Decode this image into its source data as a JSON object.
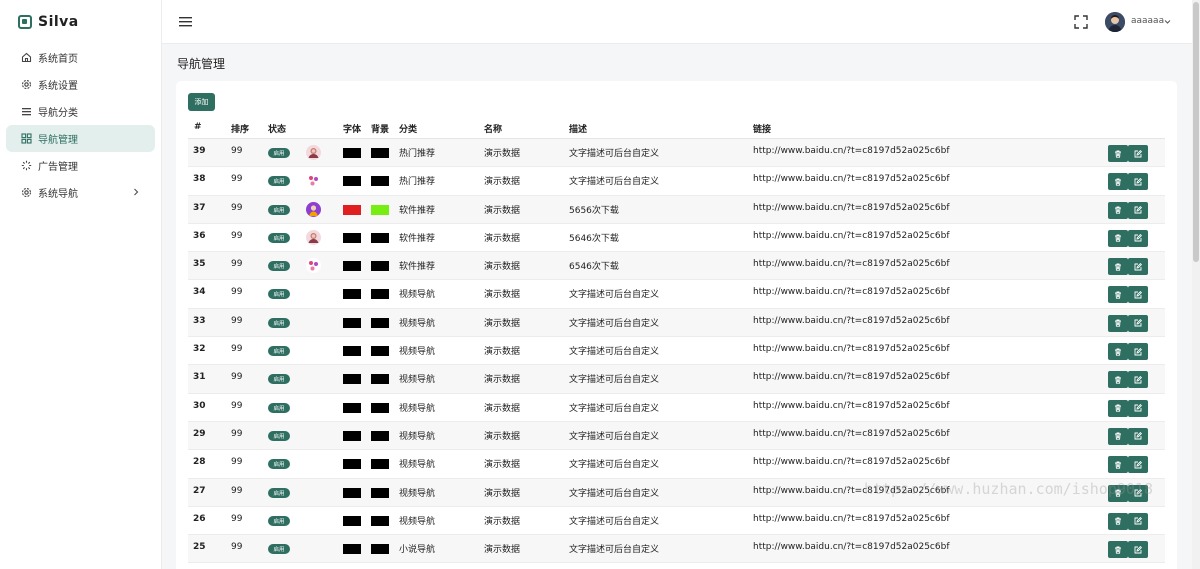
{
  "app": {
    "name": "Silva"
  },
  "sidebar": {
    "items": [
      {
        "label": "系统首页",
        "icon": "home-icon"
      },
      {
        "label": "系统设置",
        "icon": "gear-icon"
      },
      {
        "label": "导航分类",
        "icon": "list-icon"
      },
      {
        "label": "导航管理",
        "icon": "grid-icon",
        "active": true
      },
      {
        "label": "广告管理",
        "icon": "spinner-icon"
      },
      {
        "label": "系统导航",
        "icon": "gear-icon",
        "has_children": true
      }
    ]
  },
  "header": {
    "username": "aaaaaa"
  },
  "page": {
    "title": "导航管理",
    "add_label": "添加"
  },
  "table": {
    "columns": [
      "#",
      "排序",
      "状态",
      "字体",
      "背景",
      "分类",
      "名称",
      "描述",
      "链接"
    ],
    "status_label": "启用",
    "rows": [
      {
        "id": "39",
        "sort": "99",
        "avatar": "pink",
        "font_color": "#000000",
        "bg_color": "#000000",
        "category": "热门推荐",
        "name": "演示数据",
        "desc": "文字描述可后台自定义",
        "link": "http://www.baidu.cn/?t=c8197d52a025c6bf"
      },
      {
        "id": "38",
        "sort": "99",
        "avatar": "flower",
        "font_color": "#000000",
        "bg_color": "#000000",
        "category": "热门推荐",
        "name": "演示数据",
        "desc": "文字描述可后台自定义",
        "link": "http://www.baidu.cn/?t=c8197d52a025c6bf"
      },
      {
        "id": "37",
        "sort": "99",
        "avatar": "purple",
        "font_color": "#e02020",
        "bg_color": "#77ee11",
        "category": "软件推荐",
        "name": "演示数据",
        "desc": "5656次下载",
        "link": "http://www.baidu.cn/?t=c8197d52a025c6bf"
      },
      {
        "id": "36",
        "sort": "99",
        "avatar": "pink",
        "font_color": "#000000",
        "bg_color": "#000000",
        "category": "软件推荐",
        "name": "演示数据",
        "desc": "5646次下载",
        "link": "http://www.baidu.cn/?t=c8197d52a025c6bf"
      },
      {
        "id": "35",
        "sort": "99",
        "avatar": "flower",
        "font_color": "#000000",
        "bg_color": "#000000",
        "category": "软件推荐",
        "name": "演示数据",
        "desc": "6546次下载",
        "link": "http://www.baidu.cn/?t=c8197d52a025c6bf"
      },
      {
        "id": "34",
        "sort": "99",
        "avatar": "",
        "font_color": "#000000",
        "bg_color": "#000000",
        "category": "视频导航",
        "name": "演示数据",
        "desc": "文字描述可后台自定义",
        "link": "http://www.baidu.cn/?t=c8197d52a025c6bf"
      },
      {
        "id": "33",
        "sort": "99",
        "avatar": "",
        "font_color": "#000000",
        "bg_color": "#000000",
        "category": "视频导航",
        "name": "演示数据",
        "desc": "文字描述可后台自定义",
        "link": "http://www.baidu.cn/?t=c8197d52a025c6bf"
      },
      {
        "id": "32",
        "sort": "99",
        "avatar": "",
        "font_color": "#000000",
        "bg_color": "#000000",
        "category": "视频导航",
        "name": "演示数据",
        "desc": "文字描述可后台自定义",
        "link": "http://www.baidu.cn/?t=c8197d52a025c6bf"
      },
      {
        "id": "31",
        "sort": "99",
        "avatar": "",
        "font_color": "#000000",
        "bg_color": "#000000",
        "category": "视频导航",
        "name": "演示数据",
        "desc": "文字描述可后台自定义",
        "link": "http://www.baidu.cn/?t=c8197d52a025c6bf"
      },
      {
        "id": "30",
        "sort": "99",
        "avatar": "",
        "font_color": "#000000",
        "bg_color": "#000000",
        "category": "视频导航",
        "name": "演示数据",
        "desc": "文字描述可后台自定义",
        "link": "http://www.baidu.cn/?t=c8197d52a025c6bf"
      },
      {
        "id": "29",
        "sort": "99",
        "avatar": "",
        "font_color": "#000000",
        "bg_color": "#000000",
        "category": "视频导航",
        "name": "演示数据",
        "desc": "文字描述可后台自定义",
        "link": "http://www.baidu.cn/?t=c8197d52a025c6bf"
      },
      {
        "id": "28",
        "sort": "99",
        "avatar": "",
        "font_color": "#000000",
        "bg_color": "#000000",
        "category": "视频导航",
        "name": "演示数据",
        "desc": "文字描述可后台自定义",
        "link": "http://www.baidu.cn/?t=c8197d52a025c6bf"
      },
      {
        "id": "27",
        "sort": "99",
        "avatar": "",
        "font_color": "#000000",
        "bg_color": "#000000",
        "category": "视频导航",
        "name": "演示数据",
        "desc": "文字描述可后台自定义",
        "link": "http://www.baidu.cn/?t=c8197d52a025c6bf"
      },
      {
        "id": "26",
        "sort": "99",
        "avatar": "",
        "font_color": "#000000",
        "bg_color": "#000000",
        "category": "视频导航",
        "name": "演示数据",
        "desc": "文字描述可后台自定义",
        "link": "http://www.baidu.cn/?t=c8197d52a025c6bf"
      },
      {
        "id": "25",
        "sort": "99",
        "avatar": "",
        "font_color": "#000000",
        "bg_color": "#000000",
        "category": "小说导航",
        "name": "演示数据",
        "desc": "文字描述可后台自定义",
        "link": "http://www.baidu.cn/?t=c8197d52a025c6bf"
      }
    ]
  },
  "watermark": "https://www.huzhan.com/ishop9018",
  "colors": {
    "accent": "#2f6f62",
    "active_bg": "#e3efec"
  }
}
